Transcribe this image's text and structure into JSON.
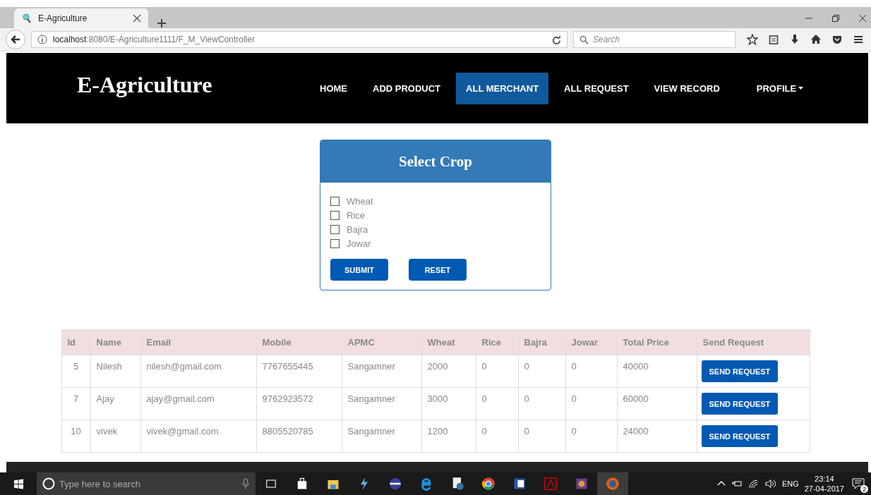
{
  "browser": {
    "tab_title": "E-Agriculture",
    "url_host": "localhost",
    "url_rest": ":8080/E-Agriculture1111/F_M_ViewController",
    "search_placeholder": "Search"
  },
  "navbar": {
    "brand": "E-Agriculture",
    "items": [
      {
        "label": "HOME",
        "selected": false
      },
      {
        "label": "ADD PRODUCT",
        "selected": false
      },
      {
        "label": "ALL MERCHANT",
        "selected": true
      },
      {
        "label": "ALL REQUEST",
        "selected": false
      },
      {
        "label": "VIEW RECORD",
        "selected": false
      }
    ],
    "profile": "PROFILE"
  },
  "form": {
    "title": "Select Crop",
    "crops": [
      {
        "label": "Wheat",
        "checked": false
      },
      {
        "label": "Rice",
        "checked": false
      },
      {
        "label": "Bajra",
        "checked": false
      },
      {
        "label": "Jowar",
        "checked": false
      }
    ],
    "buttons": [
      "SUBMIT",
      "RESET"
    ]
  },
  "table": {
    "columns": [
      "Id",
      "Name",
      "Email",
      "Mobile",
      "APMC",
      "Wheat",
      "Rice",
      "Bajra",
      "Jowar",
      "Total Price",
      "Send Request"
    ],
    "rows": [
      {
        "cells": [
          "5",
          "Nilesh",
          "nilesh@gmail.com",
          "7767655445",
          "Sangamner",
          "2000",
          "0",
          "0",
          "0",
          "40000"
        ],
        "button": "SEND REQUEST"
      },
      {
        "cells": [
          "7",
          "Ajay",
          "ajay@gmail.com",
          "9762923572",
          "Sangamner",
          "3000",
          "0",
          "0",
          "0",
          "60000"
        ],
        "button": "SEND REQUEST"
      },
      {
        "cells": [
          "10",
          "vivek",
          "vivek@gmail.com",
          "8805520785",
          "Sangamner",
          "1200",
          "0",
          "0",
          "0",
          "24000"
        ],
        "button": "SEND REQUEST"
      }
    ]
  },
  "taskbar": {
    "search_placeholder": "Type here to search",
    "language": "ENG",
    "time": "23:14",
    "date": "27-04-2017",
    "notification_count": "2"
  }
}
